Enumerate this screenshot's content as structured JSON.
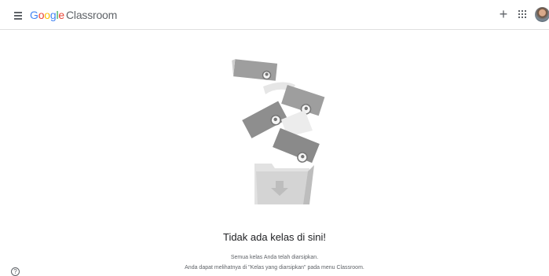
{
  "header": {
    "menu_icon": "hamburger-menu-icon",
    "brand": {
      "letters": [
        "G",
        "o",
        "o",
        "g",
        "l",
        "e"
      ],
      "product": "Classroom"
    },
    "create_icon": "plus-icon",
    "create_glyph": "+",
    "apps_icon": "apps-grid-icon",
    "avatar_icon": "user-avatar"
  },
  "empty_state": {
    "illustration_icon": "archived-classes-folder-illustration",
    "title": "Tidak ada kelas di sini!",
    "line1": "Semua kelas Anda telah diarsipkan.",
    "line2": "Anda dapat melihatnya di \"Kelas yang diarsipkan\" pada menu Classroom."
  },
  "help": {
    "icon": "help-circle-icon",
    "glyph": "?"
  },
  "colors": {
    "google_blue": "#4285f4",
    "google_red": "#ea4335",
    "google_yellow": "#fbbc05",
    "google_green": "#34a853",
    "icon_gray": "#5f6368"
  }
}
